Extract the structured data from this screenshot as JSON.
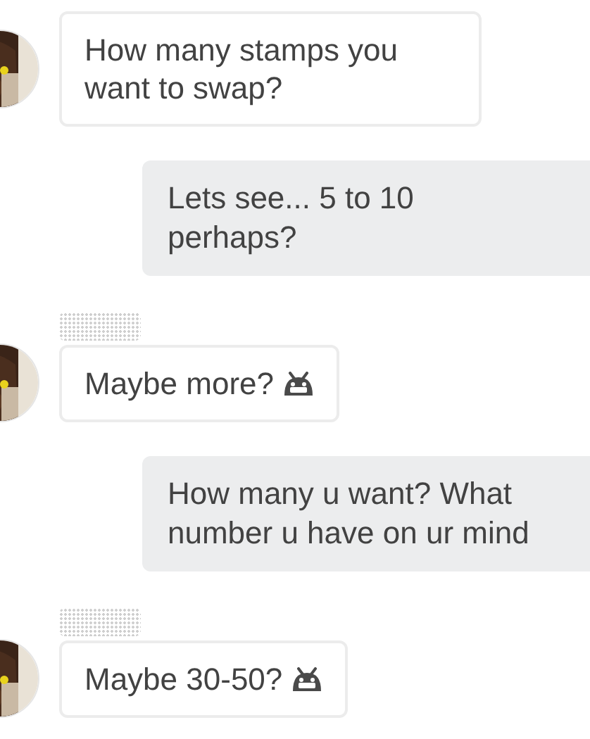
{
  "messages": [
    {
      "kind": "incoming",
      "text": "How many stamps you want to swap?",
      "emoji": false,
      "sender_label": false
    },
    {
      "kind": "outgoing",
      "text": "Lets see... 5 to 10 perhaps?"
    },
    {
      "kind": "incoming",
      "text": "Maybe more?",
      "emoji": true,
      "sender_label": true
    },
    {
      "kind": "outgoing",
      "text": "How many u want? What number u have on ur mind"
    },
    {
      "kind": "incoming",
      "text": "Maybe 30-50?",
      "emoji": true,
      "sender_label": true
    }
  ]
}
